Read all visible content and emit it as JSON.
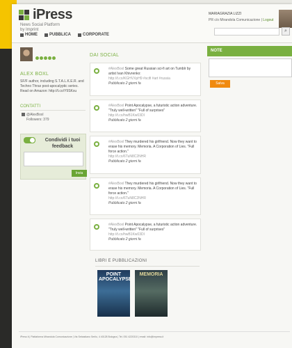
{
  "brand": {
    "name": "iPress",
    "subtitle_lines": [
      "News Social Platform",
      "by Imprint"
    ]
  },
  "nav": [
    {
      "label": "HOME",
      "icon": "home-icon"
    },
    {
      "label": "PUBBLICA",
      "icon": "publish-icon"
    },
    {
      "label": "CORPORATE",
      "icon": "corporate-icon"
    }
  ],
  "user": {
    "name": "MARIAGRAZIA LIZZI",
    "org": "PR c/o Mirandola Comunicazione",
    "logout": "Logout"
  },
  "profile": {
    "name": "ALEX BOXL",
    "rating_stars": 5,
    "bio": "SF/F author, including S.T.A.L.K.E.R. and Techno Thrax post-apocalyptic series. Read on Amazon: http://t.co/Y9SKxu"
  },
  "contacts": {
    "title": "CONTATTI",
    "handle": "@AlexBoxl",
    "followers": "Followers: 379"
  },
  "share": {
    "title": "Condividi i tuoi feedback",
    "button": "Invia"
  },
  "feed": {
    "title": "DAI SOCIAL",
    "items": [
      {
        "source": "#AlexBoxl",
        "text": "Some great Russian sci-fi art on Tumblr by artist Ivan Khivrenko:",
        "link": "http://t.co/KGHVXpH9 #scifi #art #russia",
        "published": "Pubblicato 2 giorni fa"
      },
      {
        "source": "#AlexBoxl",
        "text": "Point Apocalypse, a futuristic action adventure. \"Truly well-written\" \"Full of surprises\"",
        "link": "http://t.co/hwB1Kw03DI",
        "published": "Pubblicato 2 giorni fa"
      },
      {
        "source": "#AlexBoxl",
        "text": "They murdered his girlfriend. Now they want to erase his memory. Memoria. A Corporation of Lies. \"Full force action.\"",
        "link": "http://t.co/6TuN8C2NHR",
        "published": "Pubblicato 2 giorni fa"
      },
      {
        "source": "#AlexBoxl",
        "text": "They murdered his girlfriend. Now they want to erase his memory. Memoria. A Corporation of Lies. \"Full force action.\"",
        "link": "http://t.co/6TuN8C2NHR",
        "published": "Pubblicato 2 giorni fa"
      },
      {
        "source": "#AlexBoxl",
        "text": "Point Apocalypse, a futuristic action adventure. \"Truly well-written\" \"Full of surprises\"",
        "link": "http://t.co/hwB1Kw03DI",
        "published": "Pubblicato 2 giorni fa"
      }
    ]
  },
  "books": {
    "title": "LIBRI E PUBBLICAZIONI",
    "items": [
      {
        "title": "POINT APOCALYPSE"
      },
      {
        "title": "MEMORIA"
      }
    ]
  },
  "notes": {
    "title": "NOTE",
    "button": "Salva"
  },
  "footer": "iPress it | Piattaforma Mirandola Comunicazione | Via Sebastiano Serlio, 4 40128 Bologna | Tel. 051 4220310 | email: info@impress.it",
  "colors": {
    "accent_green": "#7ab041",
    "button_orange": "#f08a10",
    "brand_yellow": "#f5c400"
  }
}
